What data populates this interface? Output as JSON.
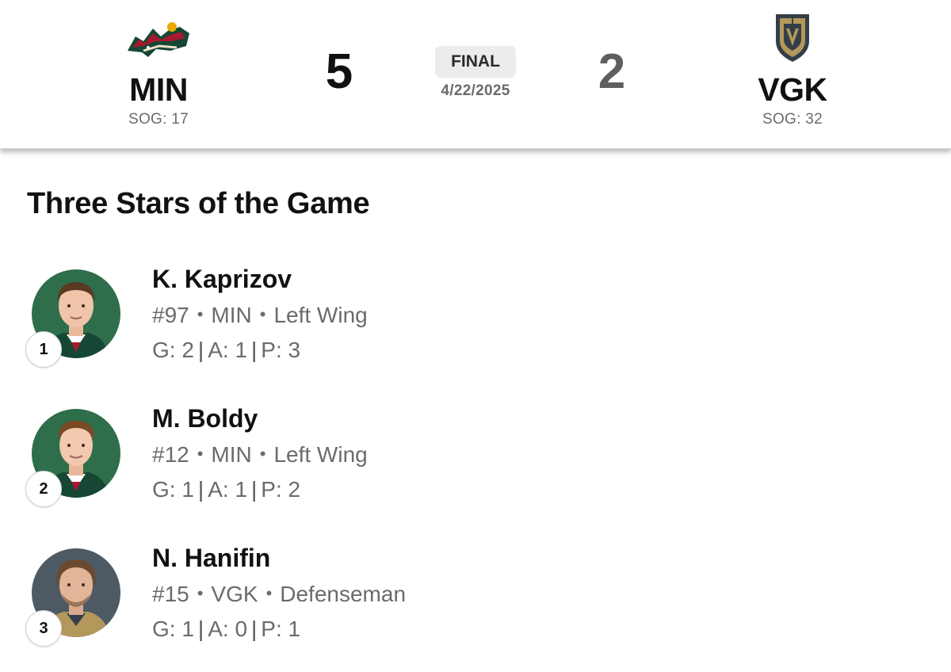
{
  "game": {
    "status": "FINAL",
    "date": "4/22/2025",
    "home": {
      "abbr": "MIN",
      "score": "5",
      "sog_label": "SOG: 17",
      "logo": "wild-logo"
    },
    "away": {
      "abbr": "VGK",
      "score": "2",
      "sog_label": "SOG: 32",
      "logo": "golden-knights-logo"
    }
  },
  "colors": {
    "min_green": "#154734",
    "min_red": "#a6192e",
    "vgk_gold": "#b4975a",
    "vgk_steel": "#333f48",
    "muted_text": "#6b6b6b"
  },
  "three_stars": {
    "title": "Three Stars of the Game",
    "stars": [
      {
        "rank": "1",
        "name": "K. Kaprizov",
        "number": "#97",
        "team": "MIN",
        "position": "Left Wing",
        "goals": "G: 2",
        "assists": "A: 1",
        "points": "P: 3"
      },
      {
        "rank": "2",
        "name": "M. Boldy",
        "number": "#12",
        "team": "MIN",
        "position": "Left Wing",
        "goals": "G: 1",
        "assists": "A: 1",
        "points": "P: 2"
      },
      {
        "rank": "3",
        "name": "N. Hanifin",
        "number": "#15",
        "team": "VGK",
        "position": "Defenseman",
        "goals": "G: 1",
        "assists": "A: 0",
        "points": "P: 1"
      }
    ]
  }
}
